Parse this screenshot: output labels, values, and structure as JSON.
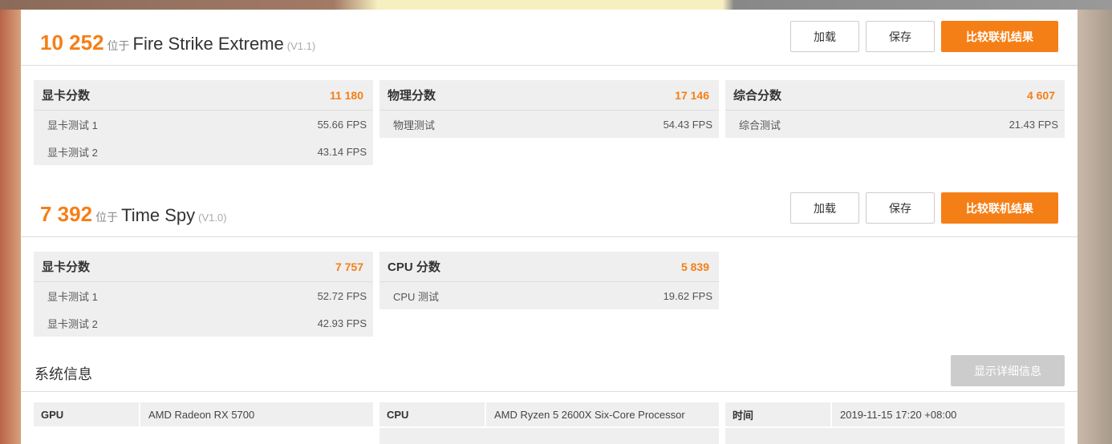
{
  "tests": [
    {
      "score": "10 252",
      "at": "位于",
      "name": "Fire Strike Extreme",
      "version": "(V1.1)",
      "load": "加载",
      "save": "保存",
      "compare": "比较联机结果",
      "panels": [
        {
          "title": "显卡分数",
          "value": "11 180",
          "rows": [
            {
              "label": "显卡测试 1",
              "value": "55.66 FPS"
            },
            {
              "label": "显卡测试 2",
              "value": "43.14 FPS"
            }
          ]
        },
        {
          "title": "物理分数",
          "value": "17 146",
          "rows": [
            {
              "label": "物理测试",
              "value": "54.43 FPS"
            }
          ]
        },
        {
          "title": "综合分数",
          "value": "4 607",
          "rows": [
            {
              "label": "综合测试",
              "value": "21.43 FPS"
            }
          ]
        }
      ]
    },
    {
      "score": "7 392",
      "at": "位于",
      "name": "Time Spy",
      "version": "(V1.0)",
      "load": "加载",
      "save": "保存",
      "compare": "比较联机结果",
      "panels": [
        {
          "title": "显卡分数",
          "value": "7 757",
          "rows": [
            {
              "label": "显卡测试 1",
              "value": "52.72 FPS"
            },
            {
              "label": "显卡测试 2",
              "value": "42.93 FPS"
            }
          ]
        },
        {
          "title": "CPU 分数",
          "value": "5 839",
          "rows": [
            {
              "label": "CPU 测试",
              "value": "19.62 FPS"
            }
          ]
        }
      ]
    }
  ],
  "system": {
    "title": "系统信息",
    "detail_button": "显示详细信息",
    "items": [
      {
        "key": "GPU",
        "value": "AMD Radeon RX 5700"
      },
      {
        "key": "CPU",
        "value": "AMD Ryzen 5 2600X Six-Core Processor"
      },
      {
        "key": "时间",
        "value": "2019-11-15 17:20 +08:00"
      }
    ]
  }
}
